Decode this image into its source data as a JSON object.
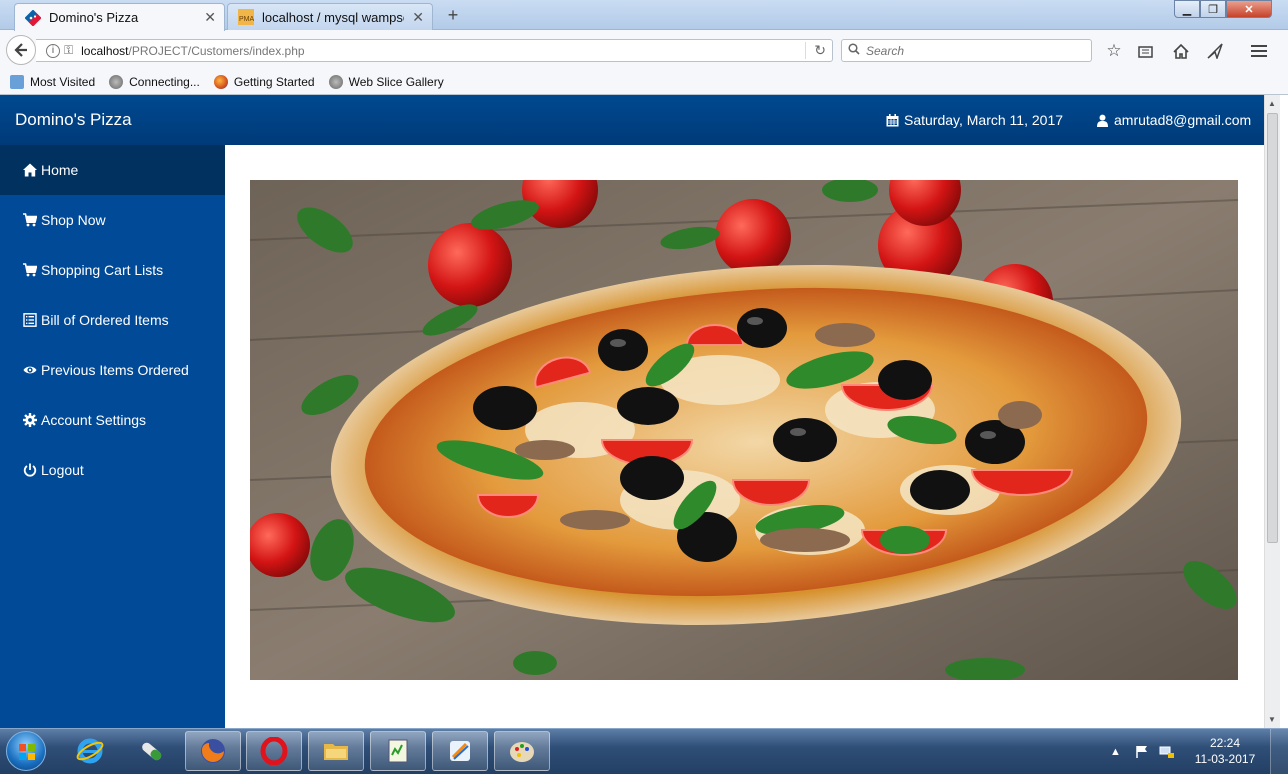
{
  "browser": {
    "tabs": [
      {
        "title": "Domino's Pizza",
        "active": true
      },
      {
        "title": "localhost / mysql wampser...",
        "active": false
      }
    ],
    "url_host": "localhost",
    "url_path": "/PROJECT/Customers/index.php",
    "search_placeholder": "Search",
    "bookmarks": [
      "Most Visited",
      "Connecting...",
      "Getting Started",
      "Web Slice Gallery"
    ]
  },
  "app": {
    "brand": "Domino's Pizza",
    "date": "Saturday, March 11, 2017",
    "user_email": "amrutad8@gmail.com",
    "header_color": "#003f82",
    "sidebar_color": "#004a97",
    "sidebar_active_color": "#00315f"
  },
  "sidebar": {
    "items": [
      {
        "label": "Home",
        "icon": "home-icon",
        "active": true
      },
      {
        "label": "Shop Now",
        "icon": "cart-icon"
      },
      {
        "label": "Shopping Cart Lists",
        "icon": "cart-icon"
      },
      {
        "label": "Bill of Ordered Items",
        "icon": "list-alt-icon"
      },
      {
        "label": "Previous Items Ordered",
        "icon": "eye-icon"
      },
      {
        "label": "Account Settings",
        "icon": "cog-icon"
      },
      {
        "label": "Logout",
        "icon": "power-icon"
      }
    ]
  },
  "taskbar": {
    "time": "22:24",
    "date": "11-03-2017"
  }
}
